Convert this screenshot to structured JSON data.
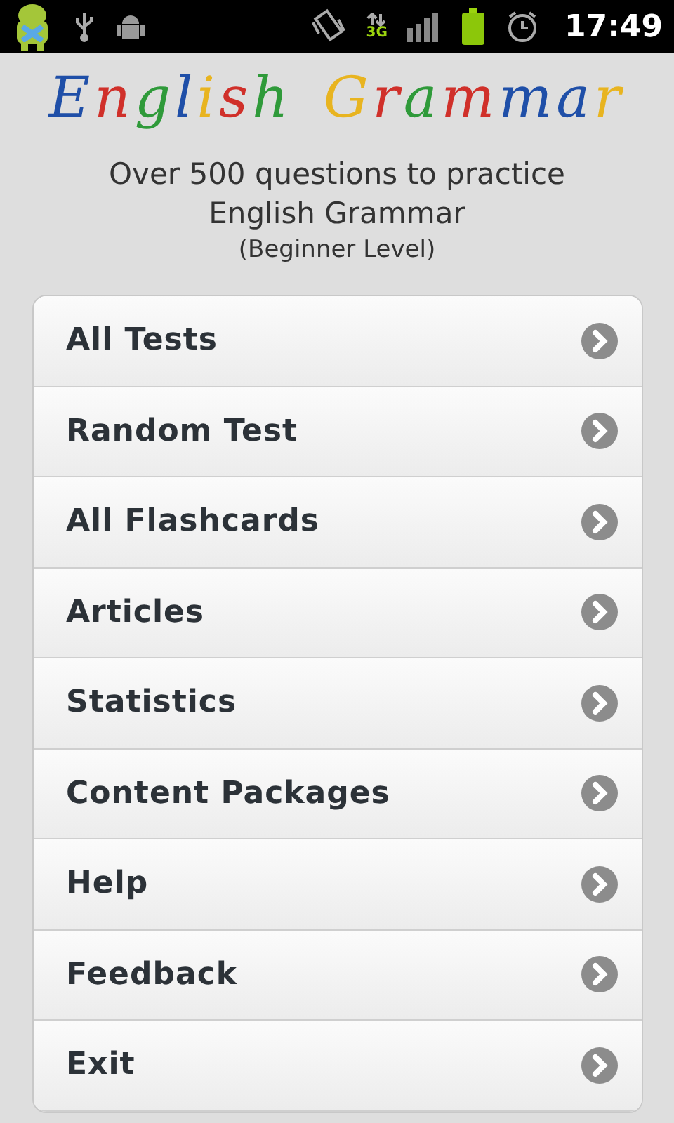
{
  "status_bar": {
    "time": "17:49",
    "network": "3G"
  },
  "logo": {
    "words": [
      {
        "letters": [
          {
            "text": "E",
            "color": "#1f4fa8"
          },
          {
            "text": "n",
            "color": "#d0302a"
          },
          {
            "text": "g",
            "color": "#2f9a3a"
          },
          {
            "text": "l",
            "color": "#1f4fa8"
          },
          {
            "text": "i",
            "color": "#e8b420"
          },
          {
            "text": "s",
            "color": "#d0302a"
          },
          {
            "text": "h",
            "color": "#2f9a3a"
          }
        ]
      },
      {
        "letters": [
          {
            "text": "G",
            "color": "#e8b420"
          },
          {
            "text": "r",
            "color": "#d0302a"
          },
          {
            "text": "a",
            "color": "#2f9a3a"
          },
          {
            "text": "m",
            "color": "#d0302a"
          },
          {
            "text": "m",
            "color": "#1f4fa8"
          },
          {
            "text": "a",
            "color": "#1f4fa8"
          },
          {
            "text": "r",
            "color": "#e8b420"
          }
        ]
      }
    ]
  },
  "intro": [
    "Over 500 questions to practice",
    "English Grammar"
  ],
  "level": "(Beginner Level)",
  "menu": [
    {
      "label": "All Tests"
    },
    {
      "label": "Random Test"
    },
    {
      "label": "All Flashcards"
    },
    {
      "label": "Articles"
    },
    {
      "label": "Statistics"
    },
    {
      "label": "Content Packages"
    },
    {
      "label": "Help"
    },
    {
      "label": "Feedback"
    },
    {
      "label": "Exit"
    }
  ]
}
